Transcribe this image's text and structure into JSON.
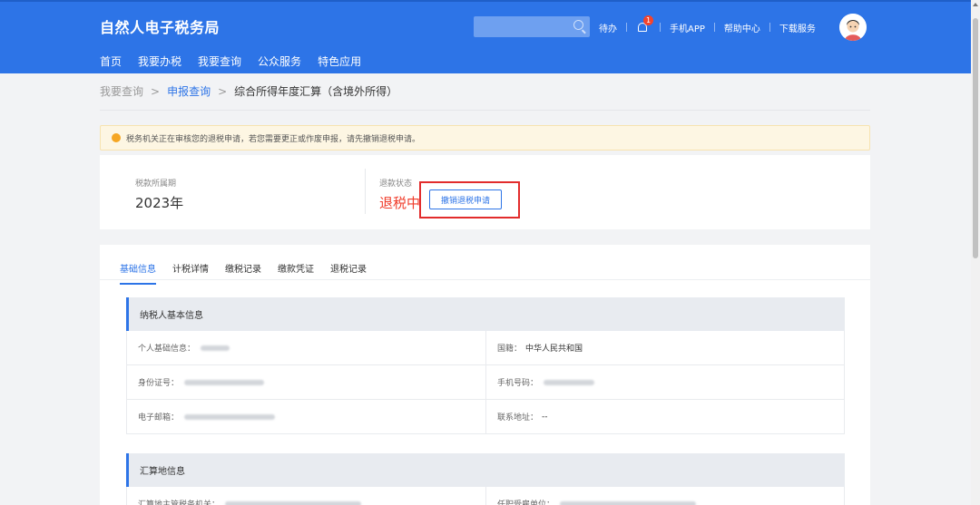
{
  "header": {
    "brand": "自然人电子税务局",
    "search_placeholder": "",
    "links": [
      "待办",
      "手机APP",
      "帮助中心",
      "下载服务"
    ],
    "bell_badge": "1",
    "nav": [
      "首页",
      "我要办税",
      "我要查询",
      "公众服务",
      "特色应用"
    ]
  },
  "breadcrumb": {
    "items": [
      "我要查询",
      "申报查询",
      "综合所得年度汇算（含境外所得）"
    ],
    "separator": ">"
  },
  "notice": {
    "text": "税务机关正在审核您的退税申请，若您需要更正或作废申报，请先撤销退税申请。"
  },
  "summary": {
    "period_label": "税款所属期",
    "period_value": "2023年",
    "status_label": "退款状态",
    "status_value": "退税中",
    "cancel_button": "撤销退税申请"
  },
  "tabs": [
    "基础信息",
    "计税详情",
    "缴税记录",
    "缴款凭证",
    "退税记录"
  ],
  "taxpayer_section": {
    "title": "纳税人基本信息",
    "rows": [
      [
        {
          "label": "个人基础信息：",
          "value": ""
        },
        {
          "label": "国籍：",
          "value": "中华人民共和国"
        }
      ],
      [
        {
          "label": "身份证号：",
          "value": ""
        },
        {
          "label": "手机号码：",
          "value": ""
        }
      ],
      [
        {
          "label": "电子邮箱：",
          "value": ""
        },
        {
          "label": "联系地址：",
          "value": "--"
        }
      ]
    ]
  },
  "settlement_section": {
    "title": "汇算地信息",
    "rows": [
      [
        {
          "label": "汇算地主管税务机关：",
          "value": ""
        },
        {
          "label": "任职受雇单位：",
          "value": ""
        }
      ]
    ]
  },
  "colors": {
    "brand_blue": "#2d74e7",
    "status_red": "#f03c2a",
    "highlight_red": "#e22c2c",
    "notice_bg": "#fdf6e3"
  }
}
